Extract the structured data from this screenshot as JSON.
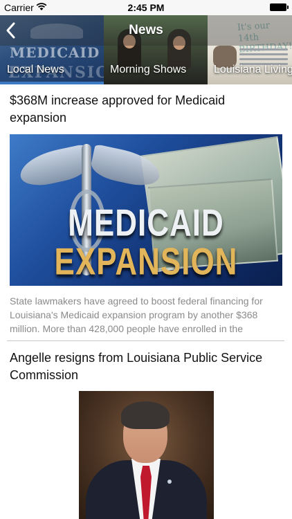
{
  "status_bar": {
    "carrier": "Carrier",
    "time": "2:45 PM"
  },
  "nav": {
    "title": "News"
  },
  "header_images": {
    "tile1_text_1": "MEDICAID",
    "tile1_text_2": "EXPANSION",
    "tile3_text_1": "It's our 14th",
    "tile3_text_2": "BIRTHDAY!"
  },
  "tabs": [
    {
      "label": "Local News",
      "selected": true
    },
    {
      "label": "Morning Shows",
      "selected": false
    },
    {
      "label": "Louisiana Living",
      "selected": false
    }
  ],
  "colors": {
    "tab_indicator": "#3d78c2",
    "summary_text": "#8a8a8a"
  },
  "articles": [
    {
      "headline": "$368M increase approved for Medicaid expansion",
      "image_text_1": "MEDICAID",
      "image_text_2": "EXPANSION",
      "summary": "State lawmakers have agreed to boost federal financing for Louisiana's Medicaid expansion program by another $368 million. More than 428,000 people have enrolled in the"
    },
    {
      "headline": "Angelle resigns from Louisiana Public Service Commission"
    }
  ]
}
